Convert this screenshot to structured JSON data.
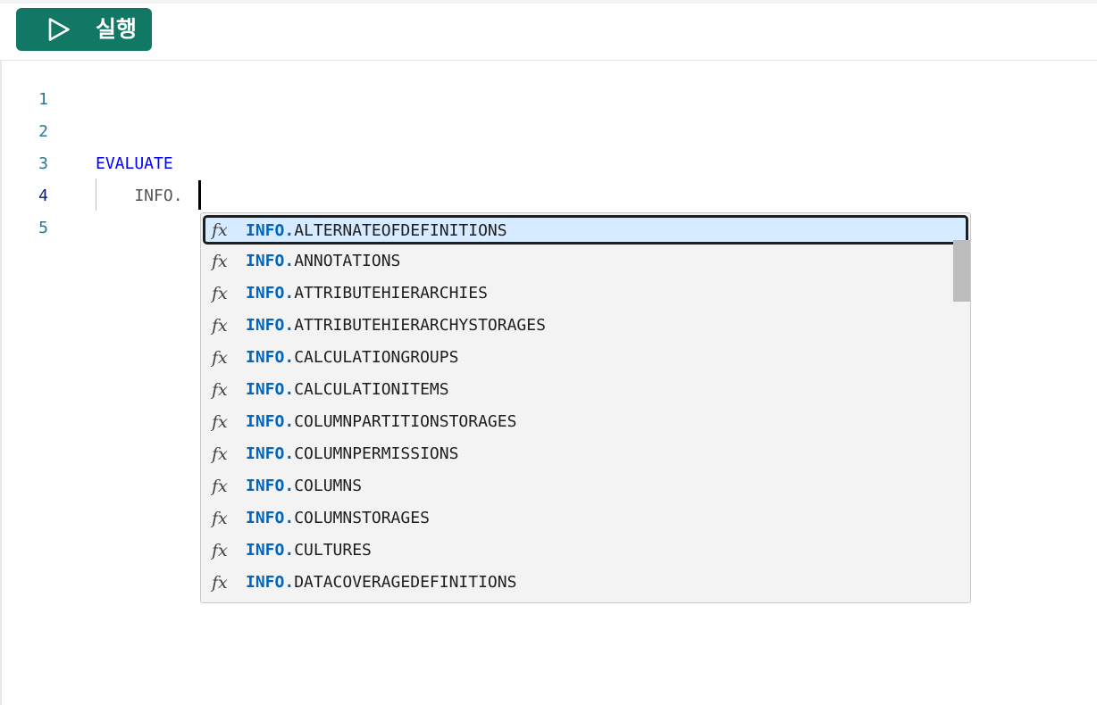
{
  "toolbar": {
    "run_button": {
      "label": "실행",
      "icon": "play-icon"
    }
  },
  "editor": {
    "line_numbers": [
      "1",
      "2",
      "3",
      "4",
      "5"
    ],
    "active_line": "4",
    "lines": [
      {
        "text": ""
      },
      {
        "text": ""
      },
      {
        "text": "EVALUATE"
      },
      {
        "text": "    INFO."
      },
      {
        "text": ""
      }
    ]
  },
  "suggestions": {
    "icon": "fx",
    "match_prefix": "INFO.",
    "selected_index": 0,
    "items": [
      {
        "rest": "ALTERNATEOFDEFINITIONS"
      },
      {
        "rest": "ANNOTATIONS"
      },
      {
        "rest": "ATTRIBUTEHIERARCHIES"
      },
      {
        "rest": "ATTRIBUTEHIERARCHYSTORAGES"
      },
      {
        "rest": "CALCULATIONGROUPS"
      },
      {
        "rest": "CALCULATIONITEMS"
      },
      {
        "rest": "COLUMNPARTITIONSTORAGES"
      },
      {
        "rest": "COLUMNPERMISSIONS"
      },
      {
        "rest": "COLUMNS"
      },
      {
        "rest": "COLUMNSTORAGES"
      },
      {
        "rest": "CULTURES"
      },
      {
        "rest": "DATACOVERAGEDEFINITIONS"
      }
    ]
  },
  "colors": {
    "run_button_bg": "#117865",
    "keyword": "#0000ff",
    "match_prefix": "#0066bf",
    "selected_bg": "#d6ebff",
    "line_number": "#237893"
  }
}
